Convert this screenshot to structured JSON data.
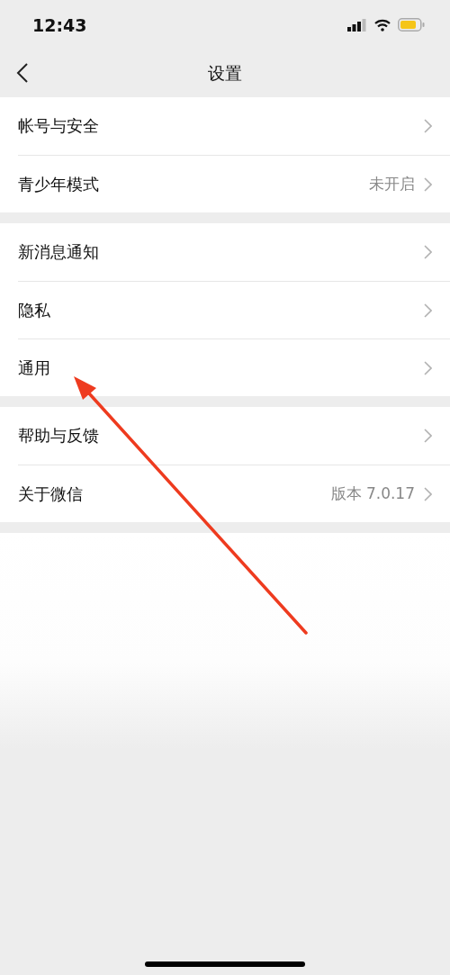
{
  "status_bar": {
    "time": "12:43"
  },
  "nav_bar": {
    "title": "设置"
  },
  "groups": [
    {
      "items": [
        {
          "label": "帐号与安全"
        },
        {
          "label": "青少年模式",
          "value": "未开启"
        }
      ]
    },
    {
      "items": [
        {
          "label": "新消息通知"
        },
        {
          "label": "隐私"
        },
        {
          "label": "通用"
        }
      ]
    },
    {
      "items": [
        {
          "label": "帮助与反馈"
        },
        {
          "label": "关于微信",
          "value": "版本 7.0.17"
        }
      ]
    }
  ]
}
